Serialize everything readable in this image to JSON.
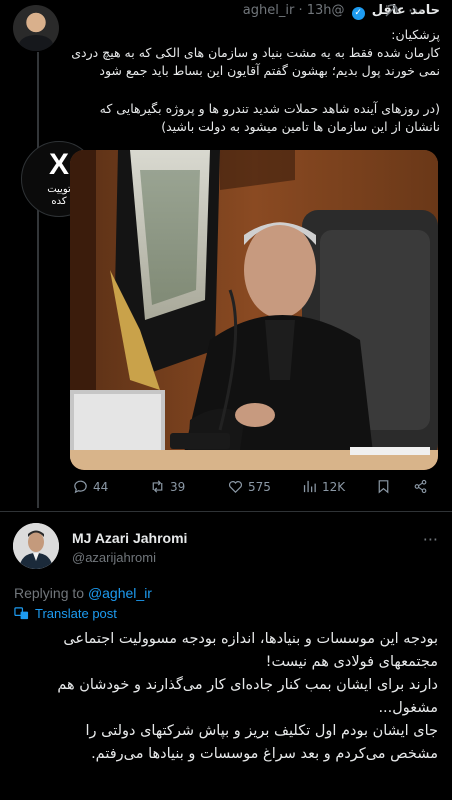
{
  "tweet1": {
    "name": "حامد عاقل",
    "handle": "@aghel_ir",
    "time": "13h",
    "text_para1_lines": [
      "پزشکیان:",
      "کارمان شده فقط به یه مشت بنیاد و سازمان های الکی که به هیچ دردی",
      "نمی خورند پول بدیم؛ بهشون گفتم آقایون این بساط باید جمع شود"
    ],
    "text_para2_lines": [
      "(در روزهای آینده شاهد حملات شدید تندرو ها و پروژه بگیرهایی که",
      "نانشان از این سازمان ها تامین میشود به دولت باشید)"
    ],
    "logo_text": {
      "mark": "X",
      "line1": "توییت",
      "line2": "کده"
    },
    "stats": {
      "replies": "44",
      "retweets": "39",
      "likes": "575",
      "views": "12K"
    }
  },
  "tweet2": {
    "name": "MJ Azari Jahromi",
    "handle": "@azarijahromi",
    "replying_prefix": "Replying to ",
    "replying_to": "@aghel_ir",
    "translate_label": "Translate post",
    "text_lines": [
      "بودجه این موسسات و بنیادها، اندازه بودجه مسوولیت اجتماعی",
      "مجتمعهای فولادی هم نیست!",
      "دارند برای ایشان بمب کنار جاده‌ای کار می‌گذارند و خودشان هم",
      "مشغول...",
      "جای ایشان بودم اول تکلیف بریز و بپاش شرکتهای دولتی را",
      "مشخص می‌کردم و بعد سراغ موسسات و بنیادها می‌رفتم."
    ]
  },
  "colors": {
    "accent": "#1d9bf0",
    "muted": "#71767b",
    "background": "#000000",
    "text": "#e7e9ea"
  },
  "icons": [
    "grok-icon",
    "more-icon",
    "reply-icon",
    "retweet-icon",
    "like-icon",
    "views-icon",
    "bookmark-icon",
    "share-icon",
    "translate-icon",
    "verified-icon"
  ]
}
